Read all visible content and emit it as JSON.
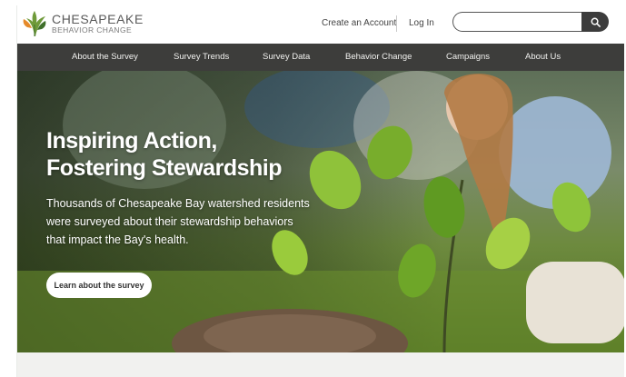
{
  "brand": {
    "name": "CHESAPEAKE",
    "subtitle": "BEHAVIOR CHANGE",
    "logo_icon": "oak-leaf-icon",
    "colors": {
      "leaf_orange": "#e58a2a",
      "leaf_green": "#6f9a3a",
      "leaf_dark": "#3f6f2a"
    }
  },
  "header": {
    "create_account": "Create an Account",
    "login": "Log In",
    "search": {
      "value": "",
      "placeholder": "",
      "button_icon": "search-icon"
    }
  },
  "nav": {
    "items": [
      {
        "label": "About the Survey"
      },
      {
        "label": "Survey Trends"
      },
      {
        "label": "Survey Data"
      },
      {
        "label": "Behavior Change"
      },
      {
        "label": "Campaigns"
      },
      {
        "label": "About Us"
      }
    ],
    "background": "#3d3d3b"
  },
  "hero": {
    "title_line1": "Inspiring Action,",
    "title_line2": "Fostering Stewardship",
    "subtitle": "Thousands of Chesapeake Bay watershed residents were surveyed about their stewardship behaviors that impact the Bay's health.",
    "cta": "Learn about the survey"
  }
}
